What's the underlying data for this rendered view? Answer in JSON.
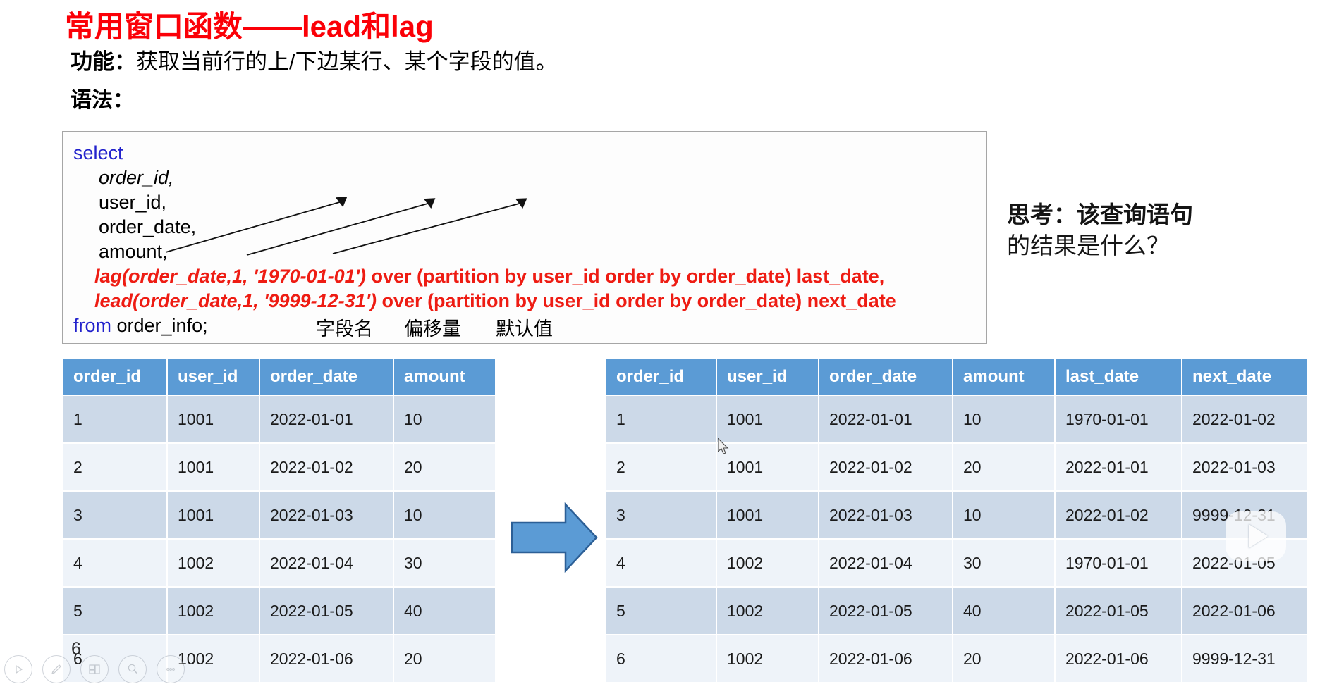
{
  "slide": {
    "title": "常用窗口函数——lead和lag",
    "function_label": "功能：",
    "function_text": "获取当前行的上/下边某行、某个字段的值。",
    "syntax_label": "语法："
  },
  "sql": {
    "keyword_select": "select",
    "columns": [
      "order_id,",
      "user_id,",
      "order_date,",
      "amount,"
    ],
    "lag_line": "lag(order_date,1, '1970-01-01')",
    "lag_rest": " over (partition by user_id order by order_date) last_date,",
    "lead_line": "lead(order_date,1, '9999-12-31')",
    "lead_rest": " over (partition by user_id order by order_date) next_date",
    "keyword_from": "from",
    "from_table": " order_info;"
  },
  "annotations": {
    "field_name": "字段名",
    "offset": "偏移量",
    "default_value": "默认值"
  },
  "thinking": {
    "label": "思考：",
    "line1": "该查询语句",
    "line2": "的结果是什么？"
  },
  "left_table": {
    "headers": [
      "order_id",
      "user_id",
      "order_date",
      "amount"
    ],
    "rows": [
      [
        "1",
        "1001",
        "2022-01-01",
        "10"
      ],
      [
        "2",
        "1001",
        "2022-01-02",
        "20"
      ],
      [
        "3",
        "1001",
        "2022-01-03",
        "10"
      ],
      [
        "4",
        "1002",
        "2022-01-04",
        "30"
      ],
      [
        "5",
        "1002",
        "2022-01-05",
        "40"
      ],
      [
        "6",
        "1002",
        "2022-01-06",
        "20"
      ]
    ]
  },
  "right_table": {
    "headers": [
      "order_id",
      "user_id",
      "order_date",
      "amount",
      "last_date",
      "next_date"
    ],
    "rows": [
      [
        "1",
        "1001",
        "2022-01-01",
        "10",
        "1970-01-01",
        "2022-01-02"
      ],
      [
        "2",
        "1001",
        "2022-01-02",
        "20",
        "2022-01-01",
        "2022-01-03"
      ],
      [
        "3",
        "1001",
        "2022-01-03",
        "10",
        "2022-01-02",
        "9999-12-31"
      ],
      [
        "4",
        "1002",
        "2022-01-04",
        "30",
        "1970-01-01",
        "2022-01-05"
      ],
      [
        "5",
        "1002",
        "2022-01-05",
        "40",
        "2022-01-05",
        "2022-01-06"
      ],
      [
        "6",
        "1002",
        "2022-01-06",
        "20",
        "2022-01-06",
        "9999-12-31"
      ]
    ]
  },
  "toolbar": {
    "slide_number": "6",
    "buttons": [
      {
        "name": "play-icon",
        "label": "播放"
      },
      {
        "name": "pen-icon",
        "label": "画笔"
      },
      {
        "name": "slides-icon",
        "label": "幻灯片"
      },
      {
        "name": "magnifier-icon",
        "label": "放大"
      },
      {
        "name": "more-icon",
        "label": "更多"
      }
    ]
  },
  "colors": {
    "title_red": "#fb0007",
    "sql_red": "#ee1c13",
    "sql_keyword_blue": "#2222cc",
    "table_header_blue": "#5b9bd5",
    "row_odd": "#ccd9e8",
    "row_even": "#eef3f9",
    "flow_arrow": "#5b9bd5"
  }
}
